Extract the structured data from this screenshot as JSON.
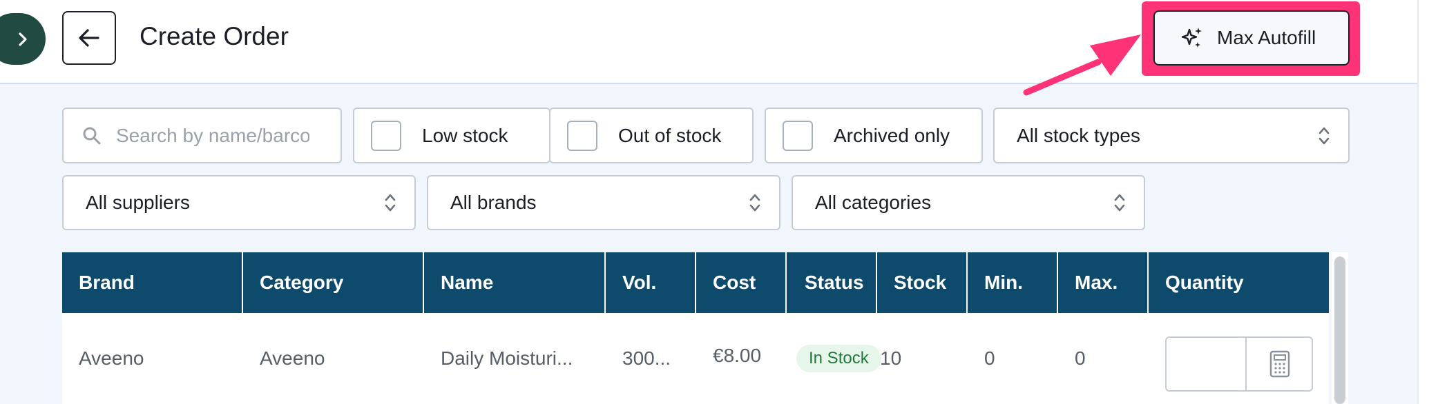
{
  "header": {
    "title": "Create Order",
    "autofill_label": "Max Autofill"
  },
  "filters": {
    "search_placeholder": "Search by name/barcode",
    "low_stock_label": "Low stock",
    "out_of_stock_label": "Out of stock",
    "archived_only_label": "Archived only",
    "stock_types_value": "All stock types",
    "suppliers_value": "All suppliers",
    "brands_value": "All brands",
    "categories_value": "All categories"
  },
  "table": {
    "columns": [
      "Brand",
      "Category",
      "Name",
      "Vol.",
      "Cost",
      "Status",
      "Stock",
      "Min.",
      "Max.",
      "Quantity"
    ],
    "rows": [
      {
        "brand": "Aveeno",
        "category": "Aveeno",
        "name": "Daily Moisturi...",
        "vol": "300...",
        "cost": "€8.00",
        "status": "In Stock",
        "stock": "10",
        "min": "0",
        "max": "0",
        "quantity": ""
      }
    ]
  },
  "colors": {
    "header_bg": "#0e4a6b",
    "highlight": "#fe3276",
    "sidebar_toggle": "#214a42",
    "status_in_stock": "#1f7a3a"
  },
  "icons": {
    "expand": "chevron-right-icon",
    "back": "arrow-left-icon",
    "autofill": "sparkles-icon",
    "search": "search-icon",
    "select": "chevron-updown-icon",
    "calculator": "calculator-icon"
  }
}
